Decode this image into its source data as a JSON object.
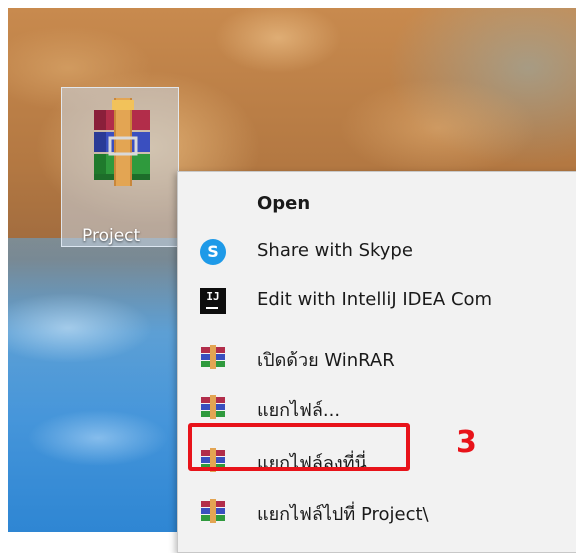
{
  "desktop": {
    "icon_label": "Project",
    "icon_name": "winrar-archive-icon"
  },
  "context_menu": {
    "items": [
      {
        "label": "Open",
        "icon": "none",
        "bold": true
      },
      {
        "label": "Share with Skype",
        "icon": "skype-icon"
      },
      {
        "label": "Edit with IntelliJ IDEA Com",
        "icon": "intellij-icon"
      },
      {
        "label": "เปิดด้วย WinRAR",
        "icon": "winrar-icon"
      },
      {
        "label": "แยกไฟล์...",
        "icon": "winrar-icon"
      },
      {
        "label": "แยกไฟล์ลงที่นี่",
        "icon": "winrar-icon"
      },
      {
        "label": "แยกไฟล์ไปที่ Project\\",
        "icon": "winrar-icon"
      }
    ]
  },
  "annotation": {
    "step_number": "3",
    "color": "#e8131a"
  },
  "icon_glyphs": {
    "skype": "S",
    "intellij": "IJ"
  }
}
